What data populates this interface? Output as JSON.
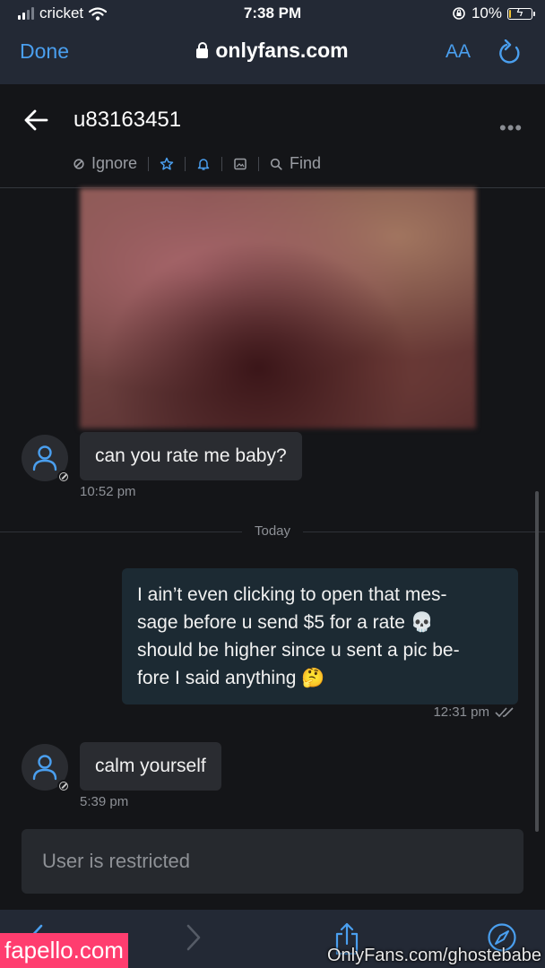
{
  "status_bar": {
    "carrier": "cricket",
    "time": "7:38 PM",
    "battery": "10%",
    "battery_level": 0.1
  },
  "browser": {
    "done_label": "Done",
    "url": "onlyfans.com",
    "text_size_label": "AA"
  },
  "chat_header": {
    "username": "u83163451",
    "actions": {
      "ignore": "Ignore",
      "find": "Find"
    }
  },
  "messages": [
    {
      "direction": "incoming",
      "type": "image",
      "blurred": true
    },
    {
      "direction": "incoming",
      "text": "can you rate me baby?",
      "time": "10:52 pm"
    },
    {
      "direction": "outgoing",
      "lines": [
        "I ain’t even clicking to open that mes-",
        "sage before u send $5 for a rate 💀",
        "should be higher since u sent a pic be-",
        "fore I said anything 🤔"
      ],
      "time": "12:31 pm",
      "read": true
    },
    {
      "direction": "incoming",
      "text": "calm yourself",
      "time": "5:39 pm"
    }
  ],
  "divider": {
    "label": "Today"
  },
  "composer": {
    "restricted_text": "User is restricted"
  },
  "watermarks": {
    "left": "fapello.com",
    "right": "OnlyFans.com/ghostebabe"
  },
  "colors": {
    "accent": "#4a9fef",
    "background": "#141518",
    "incoming_bubble": "#2a2c31",
    "outgoing_bubble": "#1c2a33"
  }
}
